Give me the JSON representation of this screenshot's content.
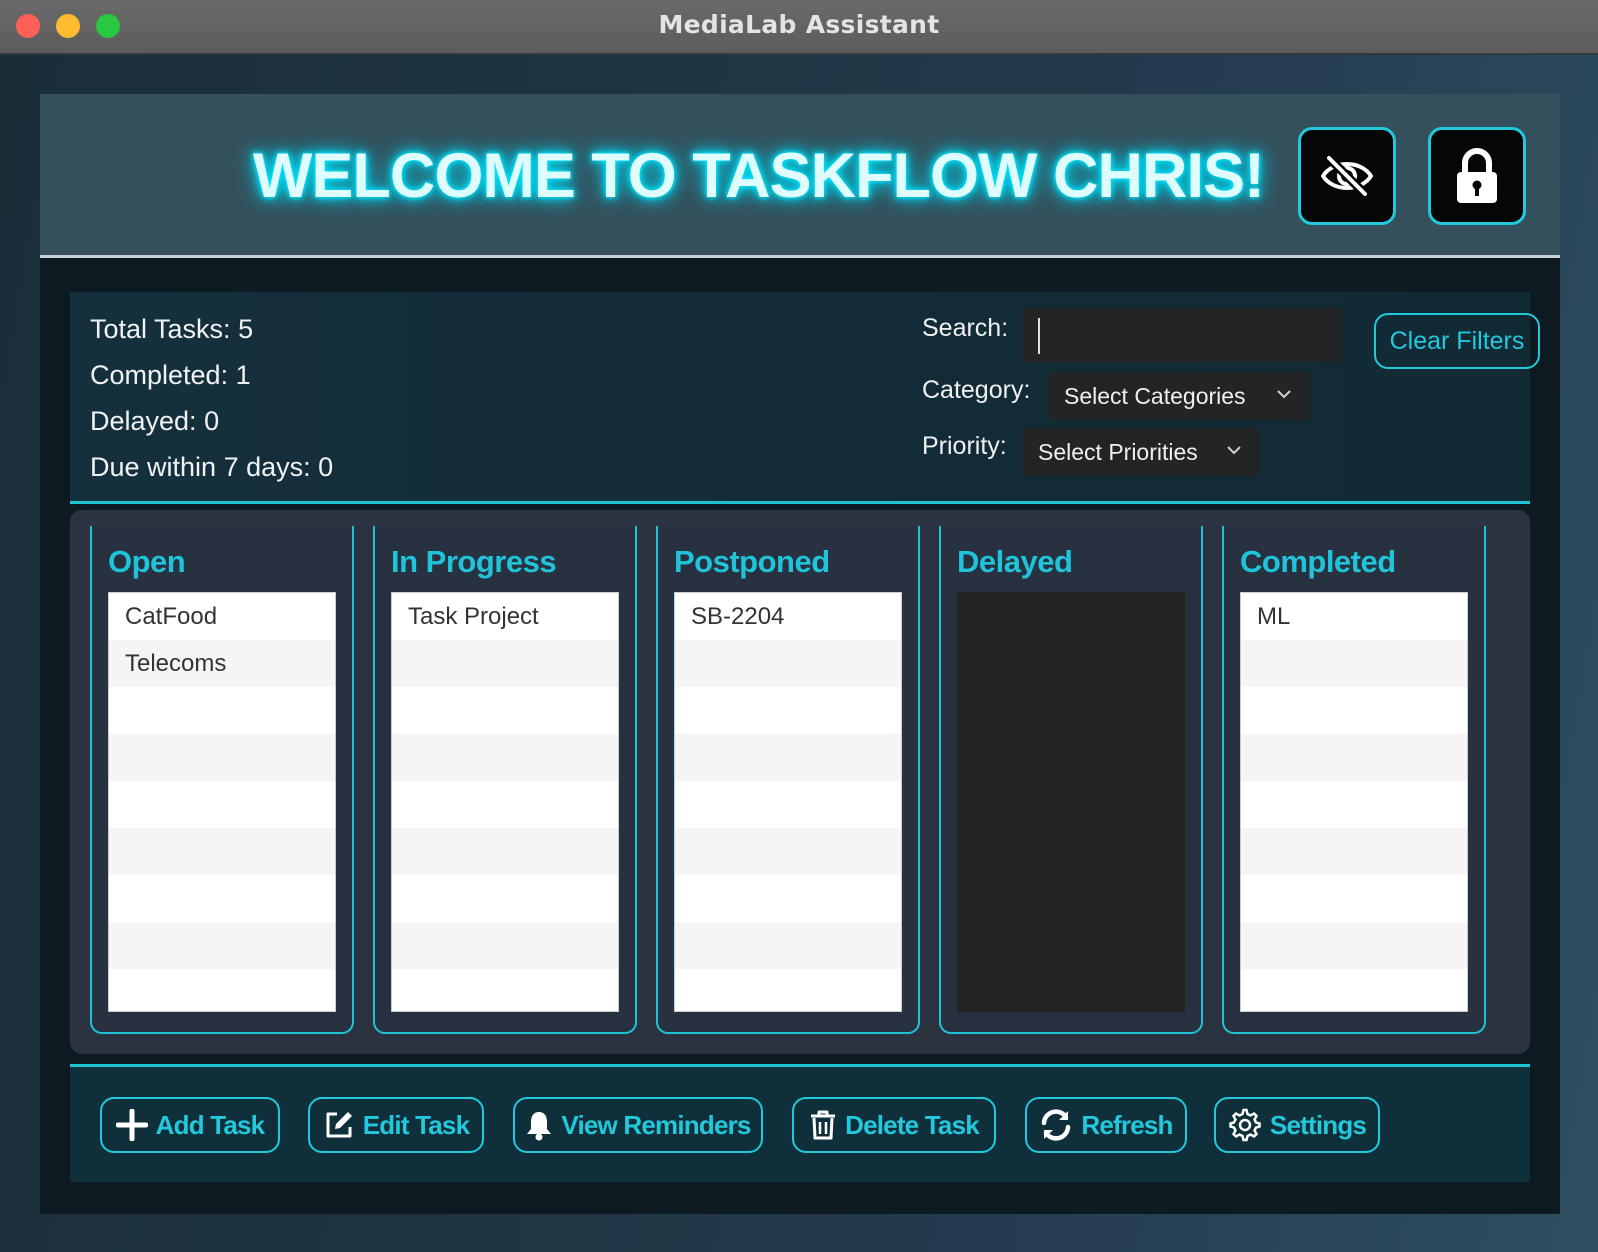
{
  "window": {
    "title": "MediaLab Assistant"
  },
  "header": {
    "welcome": "WELCOME TO TASKFLOW CHRIS!",
    "hide_icon": "eye-slash-icon",
    "lock_icon": "lock-icon"
  },
  "stats": {
    "total": "Total Tasks: 5",
    "completed": "Completed: 1",
    "delayed": "Delayed: 0",
    "due_soon": "Due within 7 days: 0"
  },
  "filters": {
    "search_label": "Search:",
    "search_value": "",
    "category_label": "Category:",
    "category_value": "Select Categories",
    "priority_label": "Priority:",
    "priority_value": "Select Priorities",
    "clear_label": "Clear Filters"
  },
  "columns": [
    {
      "title": "Open",
      "items": [
        "CatFood",
        "Telecoms"
      ]
    },
    {
      "title": "In Progress",
      "items": [
        "Task Project"
      ]
    },
    {
      "title": "Postponed",
      "items": [
        "SB-2204"
      ]
    },
    {
      "title": "Delayed",
      "items": []
    },
    {
      "title": "Completed",
      "items": [
        "ML"
      ]
    }
  ],
  "actions": {
    "add": "Add Task",
    "edit": "Edit Task",
    "reminders": "View Reminders",
    "delete": "Delete Task",
    "refresh": "Refresh",
    "settings": "Settings"
  },
  "colors": {
    "accent": "#22c8dc",
    "header_bg": "#34505c",
    "app_bg": "#0e1a22"
  }
}
